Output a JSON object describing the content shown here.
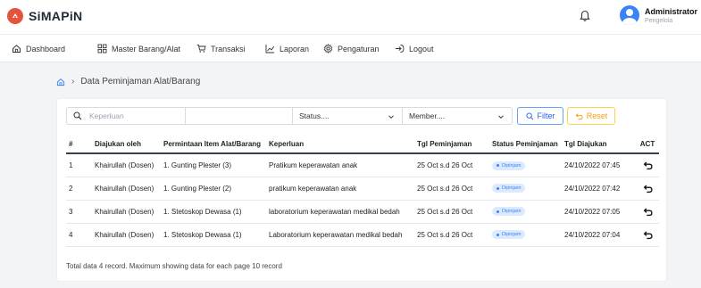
{
  "app": {
    "name": "SiMAPiN",
    "brand_color": "#e5533d",
    "accent_color": "#3b82f6"
  },
  "user": {
    "name": "Administrator",
    "role": "Pengelola"
  },
  "nav": {
    "items": [
      {
        "label": "Dashboard",
        "icon": "home-icon"
      },
      {
        "label": "Master Barang/Alat",
        "icon": "grid-icon"
      },
      {
        "label": "Transaksi",
        "icon": "cart-icon"
      },
      {
        "label": "Laporan",
        "icon": "chart-icon"
      },
      {
        "label": "Pengaturan",
        "icon": "gear-icon"
      },
      {
        "label": "Logout",
        "icon": "logout-icon"
      }
    ]
  },
  "breadcrumb": {
    "current": "Data Peminjaman Alat/Barang"
  },
  "filters": {
    "search_placeholder": "Keperluan",
    "status_label": "Status....",
    "member_label": "Member....",
    "filter_label": "Filter",
    "reset_label": "Reset"
  },
  "table": {
    "headers": [
      "#",
      "Diajukan oleh",
      "Permintaan Item Alat/Barang",
      "Keperluan",
      "Tgl Peminjaman",
      "Status Peminjaman",
      "Tgl Diajukan",
      "ACT"
    ],
    "rows": [
      {
        "no": "1",
        "by": "Khairullah (Dosen)",
        "item": "1. Gunting Plester (3)",
        "purpose": "Pratikum keperawatan anak",
        "date": "25 Oct s.d 26 Oct",
        "status": "Dipinjam",
        "submitted": "24/10/2022 07:45"
      },
      {
        "no": "2",
        "by": "Khairullah (Dosen)",
        "item": "1. Gunting Plester (2)",
        "purpose": "pratikum keperawatan anak",
        "date": "25 Oct s.d 26 Oct",
        "status": "Dipinjam",
        "submitted": "24/10/2022 07:42"
      },
      {
        "no": "3",
        "by": "Khairullah (Dosen)",
        "item": "1. Stetoskop Dewasa (1)",
        "purpose": "laboratorium keperawatan medikal bedah",
        "date": "25 Oct s.d 26 Oct",
        "status": "Dipinjam",
        "submitted": "24/10/2022 07:05"
      },
      {
        "no": "4",
        "by": "Khairullah (Dosen)",
        "item": "1. Stetoskop Dewasa (1)",
        "purpose": "Laboratorium keperawatan medikal bedah",
        "date": "25 Oct s.d 26 Oct",
        "status": "Dipinjam",
        "submitted": "24/10/2022 07:04"
      }
    ]
  },
  "footer": {
    "note": "Total data 4 record. Maximum showing data for each page 10 record"
  }
}
